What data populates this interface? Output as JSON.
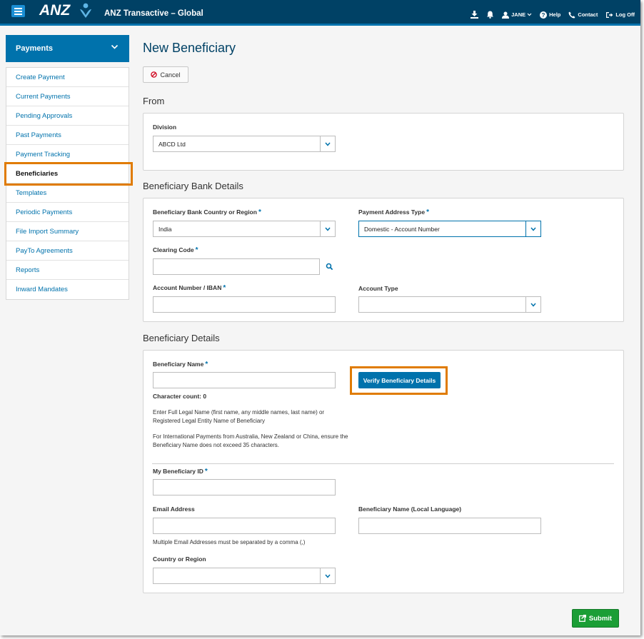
{
  "header": {
    "logo_text": "ANZ",
    "app_title": "ANZ Transactive – Global",
    "user_label": "JANE",
    "help_label": "Help",
    "contact_label": "Contact",
    "logoff_label": "Log Off"
  },
  "sidebar": {
    "section_label": "Payments",
    "items": [
      {
        "label": "Create Payment"
      },
      {
        "label": "Current Payments"
      },
      {
        "label": "Pending Approvals"
      },
      {
        "label": "Past Payments"
      },
      {
        "label": "Payment Tracking"
      },
      {
        "label": "Beneficiaries",
        "active": true
      },
      {
        "label": "Templates"
      },
      {
        "label": "Periodic Payments"
      },
      {
        "label": "File Import Summary"
      },
      {
        "label": "PayTo Agreements"
      },
      {
        "label": "Reports"
      },
      {
        "label": "Inward Mandates"
      }
    ]
  },
  "page": {
    "title": "New Beneficiary",
    "cancel_label": "Cancel"
  },
  "from": {
    "section_title": "From",
    "division_label": "Division",
    "division_value": "ABCD Ltd"
  },
  "bank": {
    "section_title": "Beneficiary Bank Details",
    "country_label": "Beneficiary Bank Country or Region",
    "country_value": "India",
    "address_type_label": "Payment Address Type",
    "address_type_value": "Domestic - Account Number",
    "clearing_label": "Clearing Code",
    "clearing_value": "",
    "account_number_label": "Account Number / IBAN",
    "account_number_value": "",
    "account_type_label": "Account Type",
    "account_type_value": ""
  },
  "details": {
    "section_title": "Beneficiary Details",
    "name_label": "Beneficiary Name",
    "name_value": "",
    "verify_label": "Verify Beneficiary Details",
    "char_count": "Character count: 0",
    "help1": "Enter Full Legal Name (first name, any middle names, last name) or Registered Legal Entity Name of Beneficiary",
    "help2": "For International Payments from Australia, New Zealand or China, ensure the Beneficiary Name does not exceed 35 characters.",
    "my_id_label": "My Beneficiary ID",
    "my_id_value": "",
    "email_label": "Email Address",
    "email_value": "",
    "email_help": "Multiple Email Addresses must be separated by a comma (,)",
    "local_name_label": "Beneficiary Name (Local Language)",
    "local_name_value": "",
    "country_label": "Country or Region",
    "country_value": ""
  },
  "actions": {
    "submit_label": "Submit"
  },
  "colors": {
    "header_bg": "#004165",
    "accent": "#0072ac",
    "highlight": "#e07b00",
    "submit": "#1b9e36",
    "required_marker": "#0072ac"
  },
  "required_marker": "*"
}
